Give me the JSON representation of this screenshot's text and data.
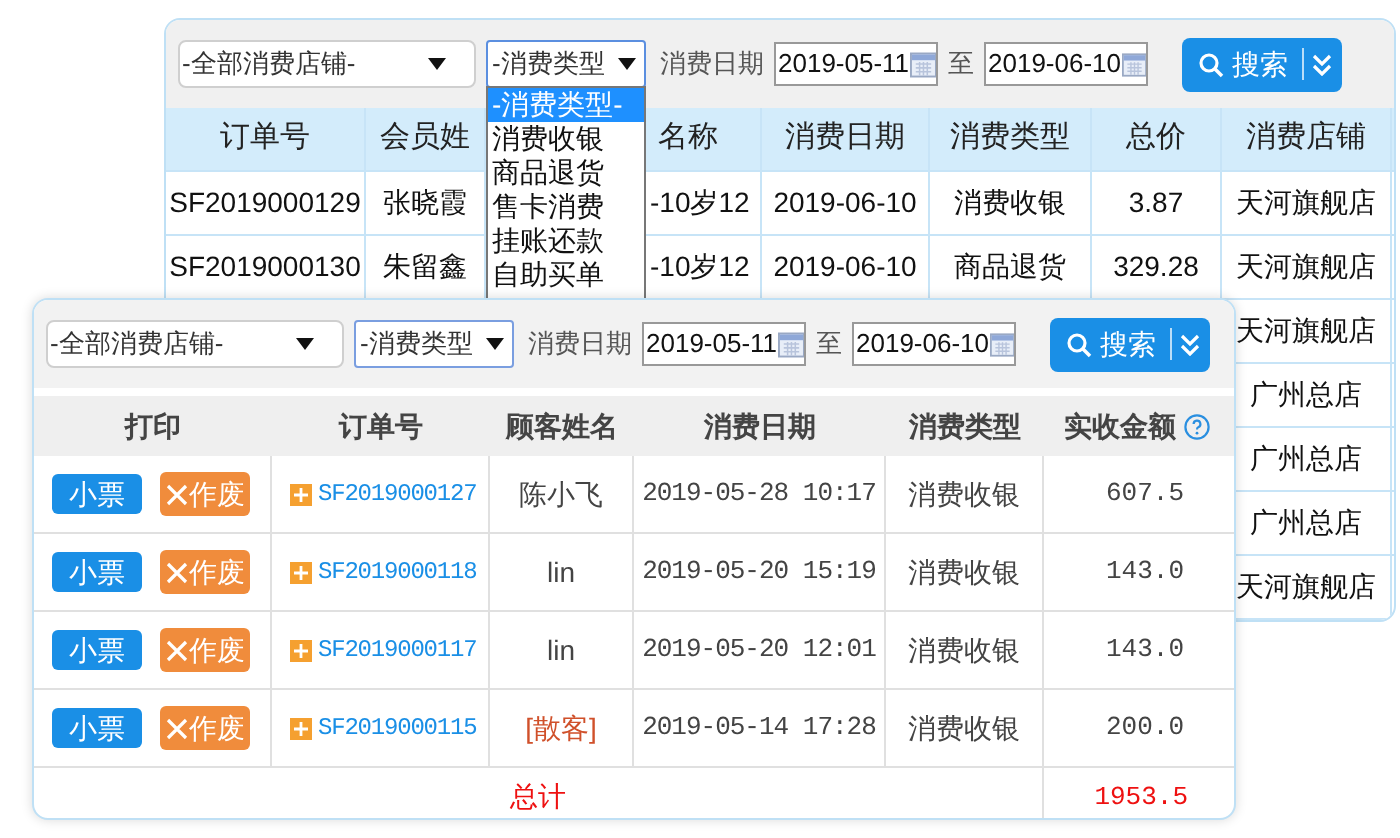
{
  "back_window": {
    "toolbar": {
      "store_select": "-全部消费店铺-",
      "type_select": "-消费类型",
      "date_label": "消费日期",
      "date_from": "2019-05-11",
      "to_label": "至",
      "date_to": "2019-06-10",
      "search_button": "搜索"
    },
    "type_dropdown": [
      {
        "label": "-消费类型-",
        "selected": true
      },
      {
        "label": "消费收银",
        "selected": false
      },
      {
        "label": "商品退货",
        "selected": false
      },
      {
        "label": "售卡消费",
        "selected": false
      },
      {
        "label": "挂账还款",
        "selected": false
      },
      {
        "label": "自助买单",
        "selected": false
      }
    ],
    "columns": [
      "订单号",
      "会员姓",
      "名称",
      "消费日期",
      "消费类型",
      "总价",
      "消费店铺"
    ],
    "rows": [
      {
        "order_no": "SF2019000129",
        "member": "张晓霞",
        "name": "-10岁12",
        "date": "2019-06-10",
        "type": "消费收银",
        "total": "3.87",
        "store": "天河旗舰店"
      },
      {
        "order_no": "SF2019000130",
        "member": "朱留鑫",
        "name": "-10岁12",
        "date": "2019-06-10",
        "type": "商品退货",
        "total": "329.28",
        "store": "天河旗舰店"
      },
      {
        "store": "天河旗舰店"
      },
      {
        "store": "广州总店"
      },
      {
        "store": "广州总店"
      },
      {
        "store": "广州总店"
      },
      {
        "store": "天河旗舰店"
      }
    ]
  },
  "front_window": {
    "toolbar": {
      "store_select": "-全部消费店铺-",
      "type_select": "-消费类型",
      "date_label": "消费日期",
      "date_from": "2019-05-11",
      "to_label": "至",
      "date_to": "2019-06-10",
      "search_button": "搜索"
    },
    "columns": [
      "打印",
      "订单号",
      "顾客姓名",
      "消费日期",
      "消费类型",
      "实收金额"
    ],
    "rows": [
      {
        "receipt_button": "小票",
        "void_button": "作废",
        "order_no": "SF2019000127",
        "customer": "陈小飞",
        "walk_in": false,
        "date": "2019-05-28 10:17",
        "type": "消费收银",
        "amount": "607.5"
      },
      {
        "receipt_button": "小票",
        "void_button": "作废",
        "order_no": "SF2019000118",
        "customer": "lin",
        "walk_in": false,
        "date": "2019-05-20 15:19",
        "type": "消费收银",
        "amount": "143.0"
      },
      {
        "receipt_button": "小票",
        "void_button": "作废",
        "order_no": "SF2019000117",
        "customer": "lin",
        "walk_in": false,
        "date": "2019-05-20 12:01",
        "type": "消费收银",
        "amount": "143.0"
      },
      {
        "receipt_button": "小票",
        "void_button": "作废",
        "order_no": "SF2019000115",
        "customer": "[散客]",
        "walk_in": true,
        "date": "2019-05-14 17:28",
        "type": "消费收银",
        "amount": "200.0"
      }
    ],
    "total": {
      "label": "总计",
      "amount": "1953.5"
    }
  }
}
